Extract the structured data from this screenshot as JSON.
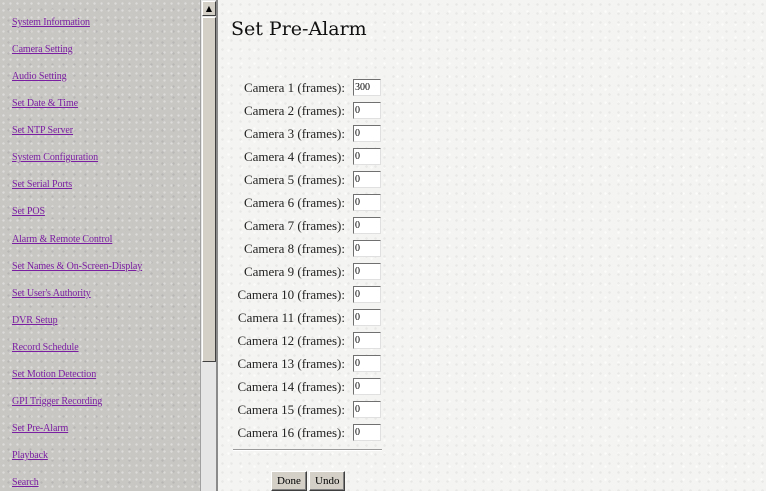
{
  "nav": {
    "items": [
      "System Information",
      "Camera Setting",
      "Audio Setting",
      "Set Date & Time",
      "Set NTP Server",
      "System Configuration",
      "Set Serial Ports",
      "Set POS",
      "Alarm & Remote Control",
      "Set Names & On-Screen-Display",
      "Set User's Authority",
      "DVR Setup",
      "Record Schedule",
      "Set Motion Detection",
      "GPI Trigger Recording",
      "Set Pre-Alarm",
      "Playback",
      "Search"
    ]
  },
  "page": {
    "title": "Set Pre-Alarm"
  },
  "cameras": [
    {
      "label": "Camera 1 (frames):",
      "value": "300"
    },
    {
      "label": "Camera 2 (frames):",
      "value": "0"
    },
    {
      "label": "Camera 3 (frames):",
      "value": "0"
    },
    {
      "label": "Camera 4 (frames):",
      "value": "0"
    },
    {
      "label": "Camera 5 (frames):",
      "value": "0"
    },
    {
      "label": "Camera 6 (frames):",
      "value": "0"
    },
    {
      "label": "Camera 7 (frames):",
      "value": "0"
    },
    {
      "label": "Camera 8 (frames):",
      "value": "0"
    },
    {
      "label": "Camera 9 (frames):",
      "value": "0"
    },
    {
      "label": "Camera 10 (frames):",
      "value": "0"
    },
    {
      "label": "Camera 11 (frames):",
      "value": "0"
    },
    {
      "label": "Camera 12 (frames):",
      "value": "0"
    },
    {
      "label": "Camera 13 (frames):",
      "value": "0"
    },
    {
      "label": "Camera 14 (frames):",
      "value": "0"
    },
    {
      "label": "Camera 15 (frames):",
      "value": "0"
    },
    {
      "label": "Camera 16 (frames):",
      "value": "0"
    }
  ],
  "buttons": {
    "done": "Done",
    "undo": "Undo"
  },
  "scrollbar": {
    "up_icon": "scroll-up-arrow",
    "up_glyph": "▲"
  },
  "colors": {
    "link": "#7b1fa2"
  }
}
